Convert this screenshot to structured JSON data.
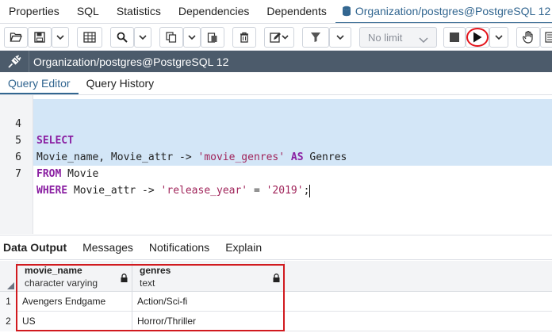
{
  "top_tabs": [
    {
      "label": "Properties"
    },
    {
      "label": "SQL"
    },
    {
      "label": "Statistics"
    },
    {
      "label": "Dependencies"
    },
    {
      "label": "Dependents"
    },
    {
      "label": "Organization/postgres@PostgreSQL 12 *"
    }
  ],
  "toolbar": {
    "limit_label": "No limit",
    "icons": [
      "open-file-icon",
      "save-icon",
      "dropdown-icon",
      "grid-icon",
      "search-icon",
      "copy-icon",
      "paste-icon",
      "delete-icon",
      "edit-icon",
      "filter-icon",
      "stop-icon",
      "execute-icon",
      "hand-icon",
      "explain-icon"
    ]
  },
  "connection": {
    "title": "Organization/postgres@PostgreSQL 12"
  },
  "editor_tabs": [
    {
      "label": "Query Editor"
    },
    {
      "label": "Query History"
    }
  ],
  "editor": {
    "lines": [
      {
        "num": "4",
        "k1": "SELECT",
        "t1": "",
        "s1": "",
        "k2": "",
        "t2": "",
        "s2": "",
        "t3": ""
      },
      {
        "num": "5",
        "k1": "",
        "t1": "Movie_name, Movie_attr -> ",
        "s1": "'movie_genres'",
        "k2": " AS",
        "t2": " Genres",
        "s2": "",
        "t3": ""
      },
      {
        "num": "6",
        "k1": "FROM",
        "t1": " Movie",
        "s1": "",
        "k2": "",
        "t2": "",
        "s2": "",
        "t3": ""
      },
      {
        "num": "7",
        "k1": "WHERE",
        "t1": " Movie_attr -> ",
        "s1": "'release_year'",
        "k2": "",
        "t2": " = ",
        "s2": "'2019'",
        "t3": ";"
      }
    ]
  },
  "results_tabs": [
    {
      "label": "Data Output"
    },
    {
      "label": "Messages"
    },
    {
      "label": "Notifications"
    },
    {
      "label": "Explain"
    }
  ],
  "grid": {
    "columns": [
      {
        "name": "movie_name",
        "type": "character varying"
      },
      {
        "name": "genres",
        "type": "text"
      }
    ],
    "rows": [
      {
        "n": "1",
        "cells": [
          "Avengers Endgame",
          "Action/Sci-fi"
        ]
      },
      {
        "n": "2",
        "cells": [
          "US",
          "Horror/Thriller"
        ]
      }
    ]
  },
  "colors": {
    "accent": "#326690",
    "connbar": "#4c5b6b",
    "selection": "#d3e6f7",
    "keyword": "#8a1fa2",
    "string": "#a0245a",
    "highlight": "#d11a1f"
  }
}
